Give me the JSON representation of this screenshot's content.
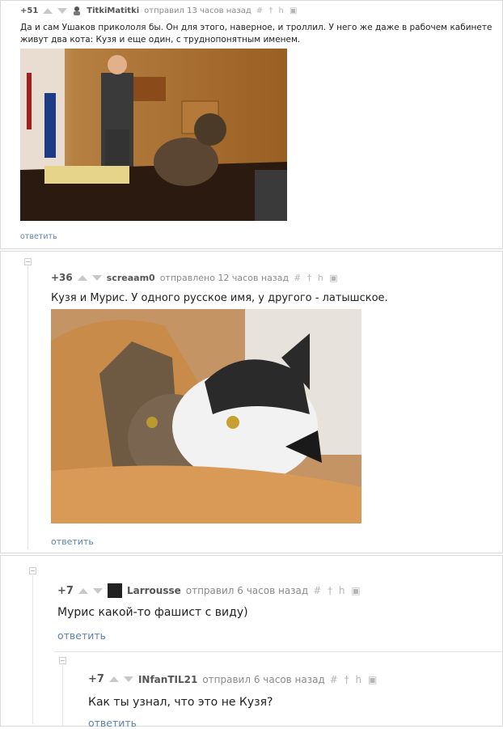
{
  "comments": [
    {
      "score": "+51",
      "author": "TitkiMatitki",
      "posted": "отправил 13 часов назад",
      "text": "Да и сам Ушаков прикололя бы. Он для этого, наверное, и троллил. У него же даже в рабочем кабинете живут два кота: Кузя и еще один, с труднопонятным именем.",
      "reply_label": "ответить"
    },
    {
      "score": "+36",
      "author": "screaam0",
      "posted": "отправлено 12 часов назад",
      "text": "Кузя и Мурис. У одного русское имя, у другого - латышское.",
      "reply_label": "ответить"
    },
    {
      "score": "+7",
      "author": "Larrousse",
      "posted": "отправил 6 часов назад",
      "text": "Мурис какой-то фашист с виду)",
      "reply_label": "ответить"
    },
    {
      "score": "+7",
      "author": "INfanTIL21",
      "posted": "отправил 6 часов назад",
      "text": "Как ты узнал, что это не Кузя?",
      "reply_label": "ответить"
    }
  ],
  "icons": [
    "arrow-up-icon",
    "arrow-down-icon",
    "hash-icon",
    "pin-icon",
    "flag-icon",
    "save-icon",
    "avatar-icon",
    "collapse-icon"
  ],
  "colors": {
    "reply_link": "#5b84b1",
    "meta_text": "#8a8a8a",
    "vote_arrow": "#c8c8c8"
  }
}
